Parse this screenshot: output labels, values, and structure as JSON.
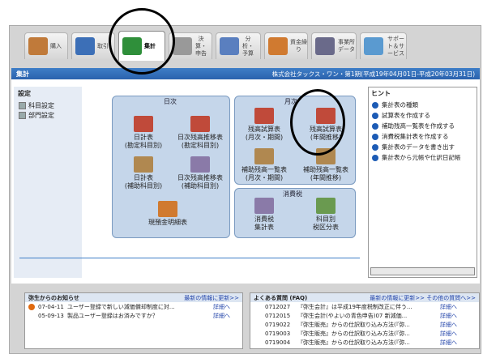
{
  "tabs": [
    {
      "label": "購入",
      "color": "#c07a3a"
    },
    {
      "label": "取引",
      "color": "#3c6fb7"
    },
    {
      "label": "集計",
      "color": "#2f8f3a"
    },
    {
      "label": "決算・申告",
      "color": "#999999"
    },
    {
      "label": "分析・予算",
      "color": "#5a7fbf"
    },
    {
      "label": "資金繰り",
      "color": "#d07a30"
    },
    {
      "label": "事業所データ",
      "color": "#6a6a8a"
    },
    {
      "label": "サポート＆サービス",
      "color": "#5a9ad0"
    }
  ],
  "header": {
    "title": "集計",
    "company": "株式会社タックス・ワン・第1期(平成19年04月01日-平成20年03月31日)"
  },
  "left": {
    "title": "設定",
    "items": [
      "科目設定",
      "部門設定"
    ]
  },
  "daily": {
    "title": "日次",
    "items": [
      "日計表\n(勘定科目別)",
      "日次残高推移表\n(勘定科目別)",
      "日計表\n(補助科目別)",
      "日次残高推移表\n(補助科目別)",
      "現預金明細表"
    ]
  },
  "monthly": {
    "title": "月次",
    "items": [
      "残高試算表\n(月次・期間)",
      "残高試算表\n(年間推移)",
      "補助残高一覧表\n(月次・期間)",
      "補助残高一覧表\n(年間推移)"
    ]
  },
  "tax": {
    "title": "消費税",
    "items": [
      "消費税\n集計表",
      "科目別\n税区分表"
    ]
  },
  "hint": {
    "title": "ヒント",
    "items": [
      "集計表の種類",
      "試算表を作成する",
      "補助残高一覧表を作成する",
      "消費税集計表を作成する",
      "集計表のデータを書き出す",
      "集計表から元帳や仕訳日記帳"
    ]
  },
  "news": {
    "title": "弥生からのお知らせ",
    "latest": "最新の情報に更新>>",
    "rows": [
      {
        "date": "07-04-11",
        "text": "ユーザー登録で新しい減価償却制度に対...",
        "link": "詳細へ"
      },
      {
        "date": "05-09-13",
        "text": "製品ユーザー登録はお済みですか？",
        "link": "詳細へ"
      }
    ]
  },
  "faq": {
    "title": "よくある質問 (FAQ)",
    "latest": "最新の情報に更新>>",
    "other": "その他の質問へ>>",
    "rows": [
      {
        "id": "0712027",
        "text": "『弥生会計』は平成19年度税制改正に伴う...",
        "link": "詳細へ"
      },
      {
        "id": "0712015",
        "text": "『弥生会計(やよいの青色申告)07 新減価...",
        "link": "詳細へ"
      },
      {
        "id": "0719022",
        "text": "『弥生販売』からの仕訳取り込み方法(『弥...",
        "link": "詳細へ"
      },
      {
        "id": "0719003",
        "text": "『弥生販売』からの仕訳取り込み方法(『弥...",
        "link": "詳細へ"
      },
      {
        "id": "0719004",
        "text": "『弥生販売』からの仕訳取り込み方法(『弥...",
        "link": "詳細へ"
      }
    ]
  }
}
